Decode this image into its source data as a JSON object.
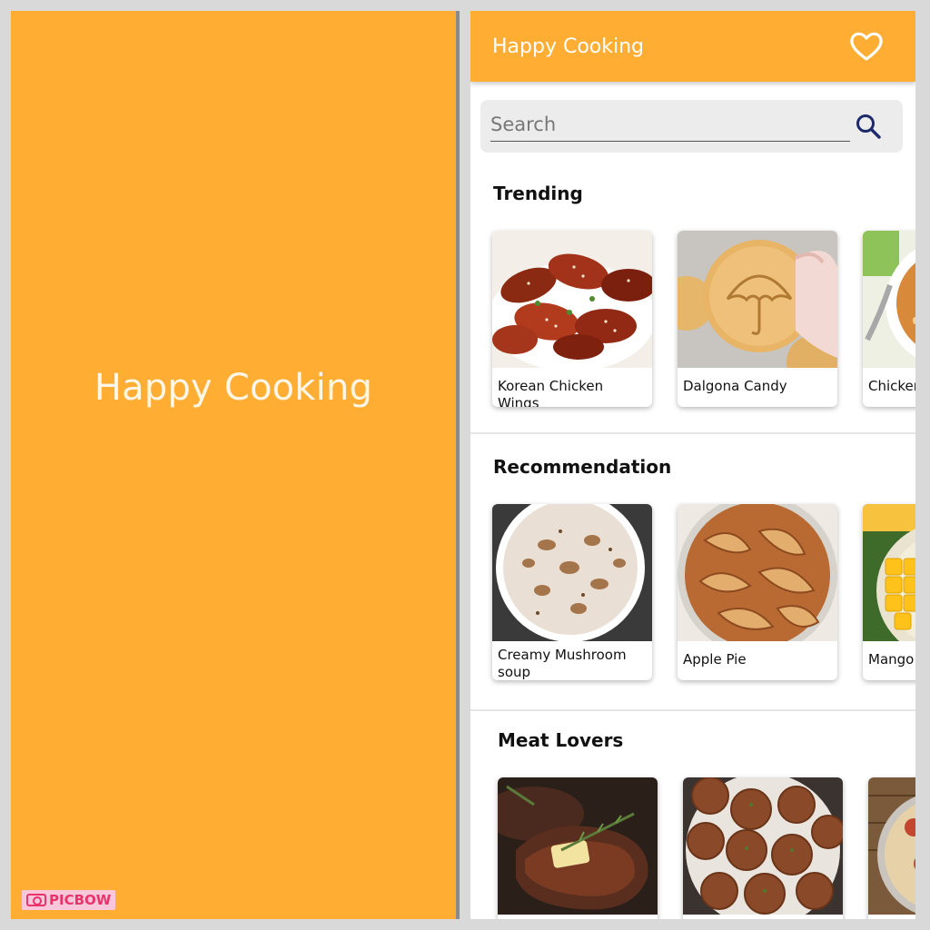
{
  "splash": {
    "title": "Happy Cooking",
    "watermark": "PICBOW"
  },
  "appbar": {
    "title": "Happy Cooking",
    "favorite_icon": "heart-outline-icon"
  },
  "search": {
    "placeholder": "Search",
    "icon": "search-icon"
  },
  "sections": {
    "trending": {
      "title": "Trending",
      "items": [
        {
          "label": "Korean Chicken Wings"
        },
        {
          "label": "Dalgona Candy"
        },
        {
          "label": "Chicken"
        }
      ]
    },
    "recommendation": {
      "title": "Recommendation",
      "items": [
        {
          "label": "Creamy Mushroom soup"
        },
        {
          "label": "Apple Pie"
        },
        {
          "label": "Mango"
        }
      ]
    },
    "meat_lovers": {
      "title": "Meat Lovers",
      "items": [
        {
          "label": ""
        },
        {
          "label": ""
        },
        {
          "label": ""
        }
      ]
    }
  },
  "colors": {
    "primary": "#FFAD33",
    "search_bg": "#ECECEC",
    "search_icon": "#1F2A6B"
  }
}
